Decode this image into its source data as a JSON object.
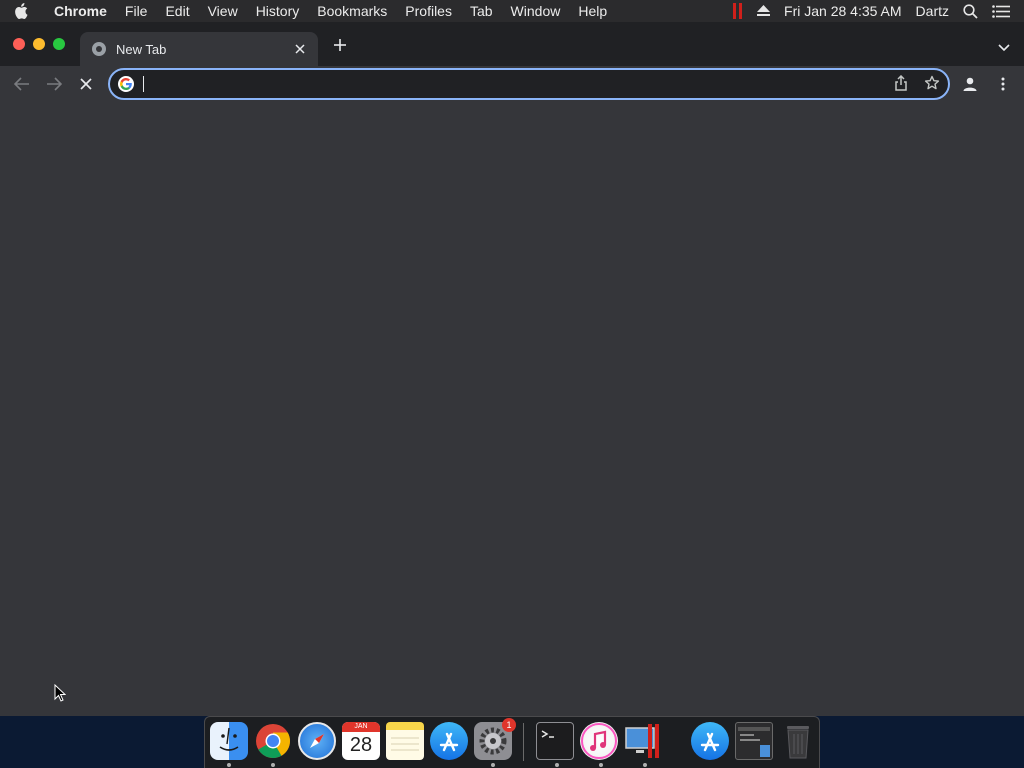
{
  "menubar": {
    "app_name": "Chrome",
    "items": [
      "File",
      "Edit",
      "View",
      "History",
      "Bookmarks",
      "Profiles",
      "Tab",
      "Window",
      "Help"
    ],
    "clock": "Fri Jan 28  4:35 AM",
    "user": "Dartz"
  },
  "browser": {
    "tab": {
      "title": "New Tab"
    },
    "omnibox": {
      "value": "",
      "placeholder": ""
    }
  },
  "dock": {
    "apps": [
      "finder",
      "chrome",
      "safari",
      "calendar",
      "notes",
      "app-store",
      "system-preferences",
      "terminal",
      "itunes",
      "remote-desktop",
      "app-store-2",
      "screenshot-preview",
      "trash"
    ],
    "calendar_month": "JAN",
    "calendar_day": "28",
    "system_preferences_badge": "1"
  },
  "colors": {
    "accent": "#8ab4f8",
    "window_bg": "#35363a",
    "tabstrip_bg": "#202124"
  }
}
